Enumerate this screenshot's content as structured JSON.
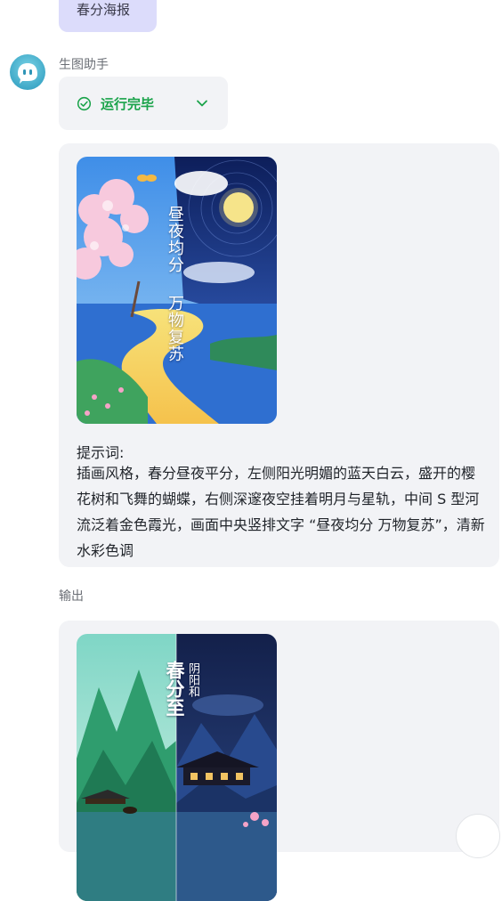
{
  "user_message": {
    "text": "春分海报"
  },
  "assistant": {
    "name": "生图助手"
  },
  "status": {
    "text": "运行完毕",
    "color": "#1aa34a"
  },
  "card1": {
    "poster_text_line1": "昼夜均分",
    "poster_text_line2": "万物复苏",
    "prompt_label": "提示词:",
    "prompt_text": "插画风格，春分昼夜平分，左侧阳光明媚的蓝天白云，盛开的樱花树和飞舞的蝴蝶，右侧深邃夜空挂着明月与星轨，中间 S 型河流泛着金色霞光，画面中央竖排文字 “昼夜均分 万物复苏”，清新水彩色调"
  },
  "output": {
    "label": "输出",
    "poster_title": "春分至",
    "poster_subtitle": "阴阳和"
  },
  "icons": {
    "status": "check-circle-icon",
    "expand": "chevron-down-icon",
    "avatar": "bot-avatar-icon"
  }
}
